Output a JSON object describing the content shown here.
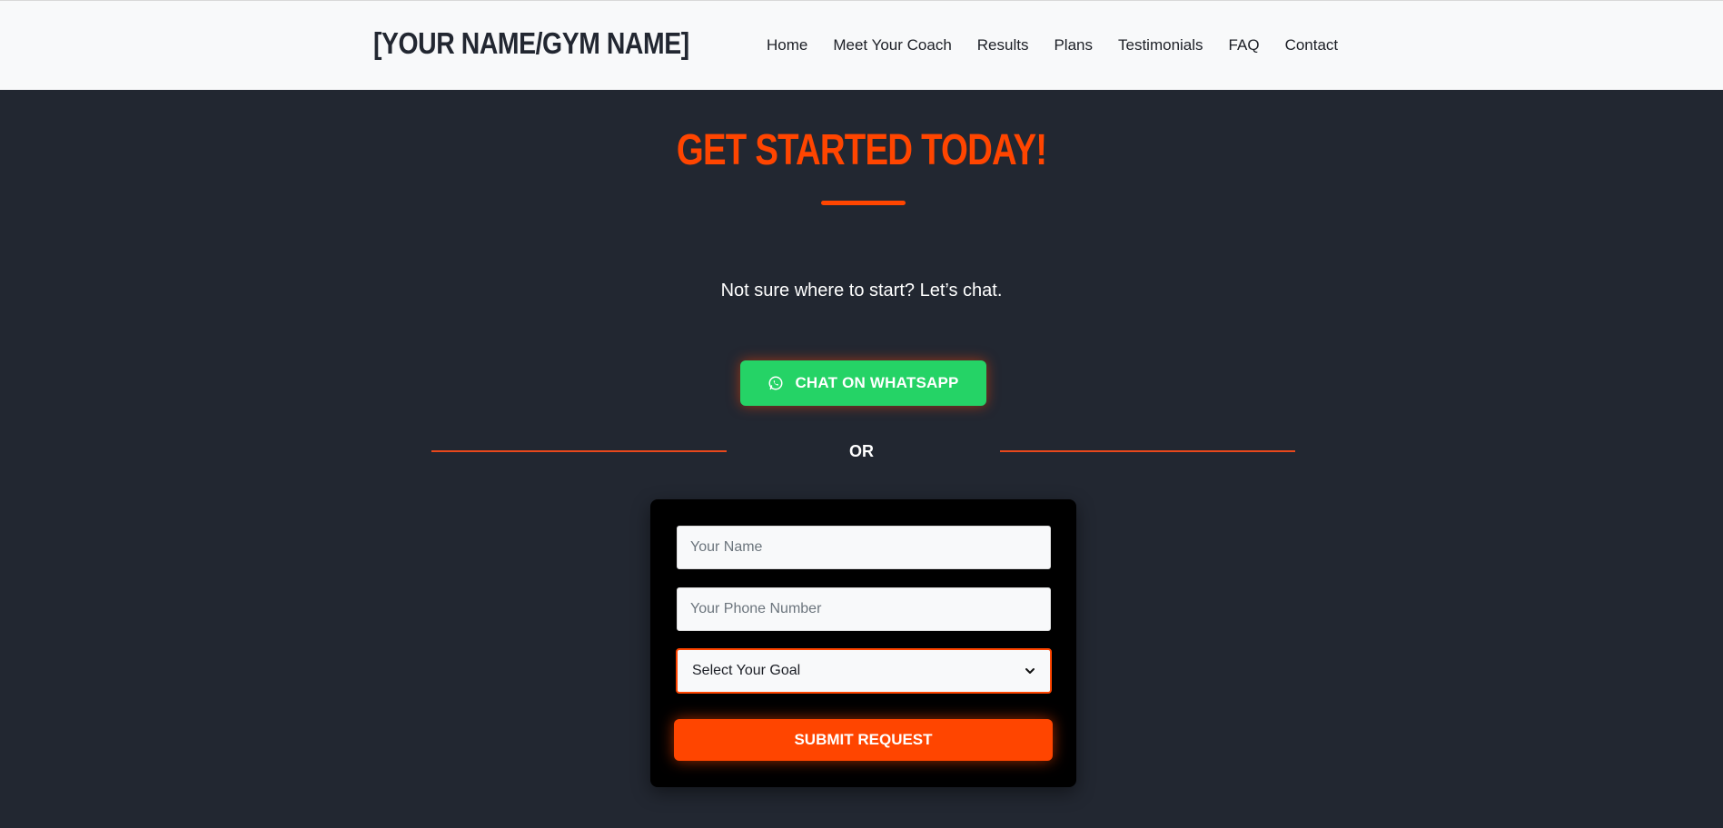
{
  "header": {
    "logo_text": "[YOUR NAME/GYM NAME]",
    "nav": [
      {
        "label": "Home"
      },
      {
        "label": "Meet Your Coach"
      },
      {
        "label": "Results"
      },
      {
        "label": "Plans"
      },
      {
        "label": "Testimonials"
      },
      {
        "label": "FAQ"
      },
      {
        "label": "Contact"
      }
    ]
  },
  "main": {
    "title": "GET STARTED TODAY!",
    "subtitle": "Not sure where to start? Let’s chat.",
    "whatsapp_button": {
      "label": "CHAT ON WHATSAPP",
      "icon": "whatsapp-icon"
    },
    "divider_text": "OR",
    "form": {
      "name_placeholder": "Your Name",
      "phone_placeholder": "Your Phone Number",
      "goal_select": {
        "selected": "Select Your Goal",
        "icon": "chevron-down-icon"
      },
      "submit_label": "SUBMIT REQUEST"
    }
  },
  "colors": {
    "background": "#222731",
    "accent": "#ff4500",
    "whatsapp": "#25d366",
    "header_bg": "#f8f9fa",
    "form_bg": "#000000"
  }
}
